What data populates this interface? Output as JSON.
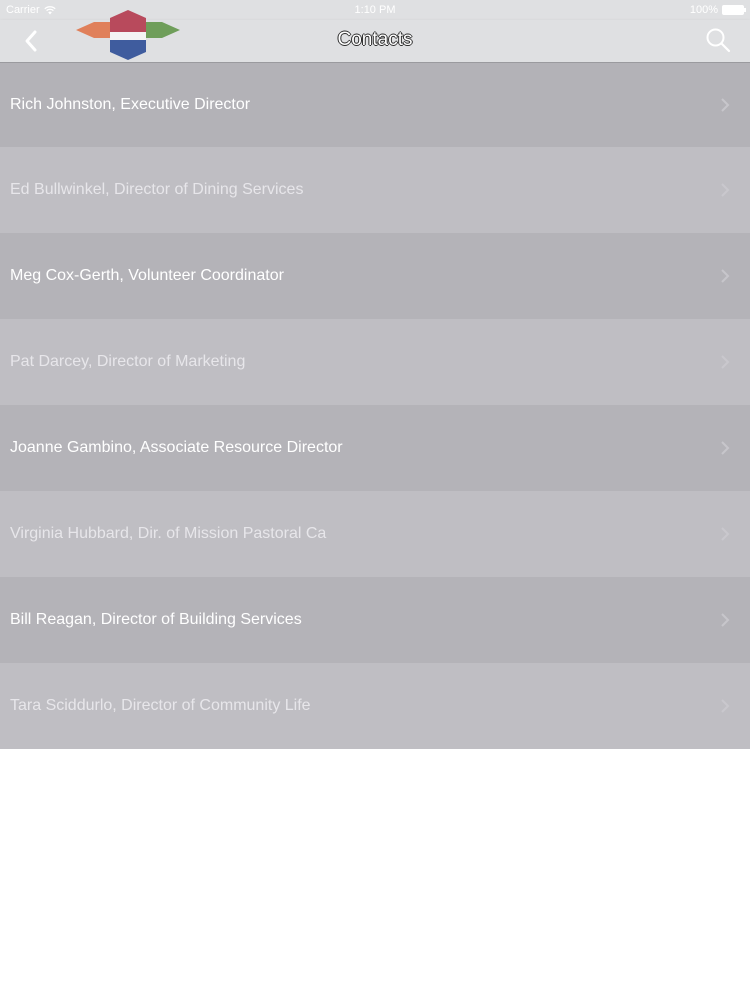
{
  "status_bar": {
    "carrier": "Carrier",
    "time": "1:10 PM",
    "battery": "100%",
    "wifi_icon": "wifi-icon",
    "battery_icon": "battery-icon"
  },
  "nav": {
    "title": "Contacts",
    "back_icon": "chevron-left-icon",
    "search_icon": "search-icon",
    "logo": "org-logo"
  },
  "colors": {
    "nav_background": "#dfe0e2",
    "row_dark": "#b4b3b8",
    "row_light": "#bfbec3",
    "logo_red": "#b84a5c",
    "logo_blue": "#3f5c9e",
    "logo_orange": "#e0805a",
    "logo_green": "#6f9e5a"
  },
  "contacts": [
    "Rich Johnston, Executive Director",
    "Ed Bullwinkel, Director of Dining Services",
    "Meg Cox-Gerth, Volunteer Coordinator",
    "Pat Darcey, Director of Marketing",
    "Joanne Gambino, Associate Resource Director",
    "Virginia Hubbard, Dir. of Mission Pastoral Ca",
    "Bill Reagan, Director of Building Services",
    "Tara Sciddurlo, Director of Community Life"
  ]
}
